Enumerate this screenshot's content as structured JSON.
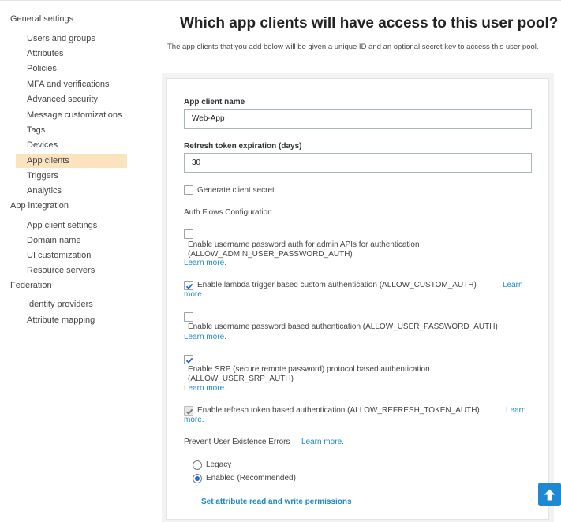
{
  "sidebar": {
    "sections": [
      {
        "label": "General settings",
        "items": [
          "Users and groups",
          "Attributes",
          "Policies",
          "MFA and verifications",
          "Advanced security",
          "Message customizations",
          "Tags",
          "Devices",
          "App clients",
          "Triggers",
          "Analytics"
        ]
      },
      {
        "label": "App integration",
        "items": [
          "App client settings",
          "Domain name",
          "UI customization",
          "Resource servers"
        ]
      },
      {
        "label": "Federation",
        "items": [
          "Identity providers",
          "Attribute mapping"
        ]
      }
    ],
    "active_item": "App clients"
  },
  "main": {
    "title": "Which app clients will have access to this user pool?",
    "intro": "The app clients that you add below will be given a unique ID and an optional secret key to access this user pool."
  },
  "form": {
    "client_name_label": "App client name",
    "client_name_value": "Web-App",
    "refresh_label": "Refresh token expiration (days)",
    "refresh_value": "30",
    "generate_secret_label": "Generate client secret",
    "auth_flows_title": "Auth Flows Configuration",
    "flows": [
      {
        "line1": "Enable username password auth for admin APIs for authentication",
        "line2": "(ALLOW_ADMIN_USER_PASSWORD_AUTH)",
        "learn": "Learn more.",
        "checked": false
      },
      {
        "line1": "Enable lambda trigger based custom authentication (ALLOW_CUSTOM_AUTH)",
        "learn_a": "Learn",
        "learn_b": "more.",
        "checked": true
      },
      {
        "line1": "Enable username password based authentication (ALLOW_USER_PASSWORD_AUTH)",
        "learn": "Learn more.",
        "checked": false
      },
      {
        "line1": "Enable SRP (secure remote password) protocol based authentication",
        "line2": "(ALLOW_USER_SRP_AUTH)",
        "learn": "Learn more.",
        "checked": true
      },
      {
        "line1": "Enable refresh token based authentication (ALLOW_REFRESH_TOKEN_AUTH)",
        "learn_a": "Learn",
        "learn_b": "more.",
        "checked": true,
        "disabled": true
      }
    ],
    "prevent_label": "Prevent User Existence Errors",
    "prevent_learn": "Learn more.",
    "radio_legacy": "Legacy",
    "radio_enabled": "Enabled (Recommended)",
    "selected_radio": "Enabled (Recommended)",
    "set_attr_link": "Set attribute read and write permissions"
  },
  "colors": {
    "accent": "#1e88c7",
    "active_bg": "#fbe3bf",
    "check_blue": "#1d6cd9"
  },
  "icons": {
    "scroll_top": "arrow-up-icon"
  }
}
